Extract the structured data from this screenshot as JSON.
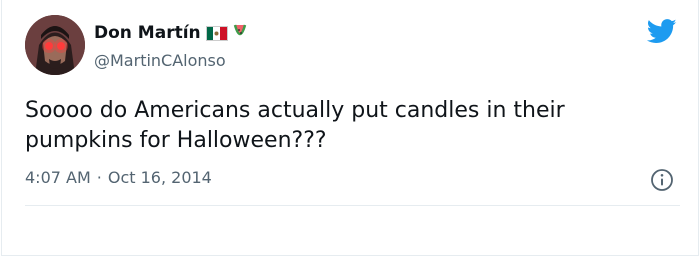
{
  "author": {
    "display_name": "Don Martín",
    "handle": "@MartinCAlonso",
    "flag_icon": "mexico-flag-icon",
    "extra_emoji_icon": "watermelon-icon"
  },
  "tweet": {
    "text": "Soooo do Americans actually put candles in their pumpkins for Halloween???",
    "time": "4:07 AM",
    "separator": "·",
    "date": "Oct 16, 2014"
  },
  "icons": {
    "brand": "twitter-bird-icon",
    "info": "info-icon"
  },
  "colors": {
    "twitter_blue": "#1d9bf0",
    "text_primary": "#0f1419",
    "text_secondary": "#536471"
  }
}
